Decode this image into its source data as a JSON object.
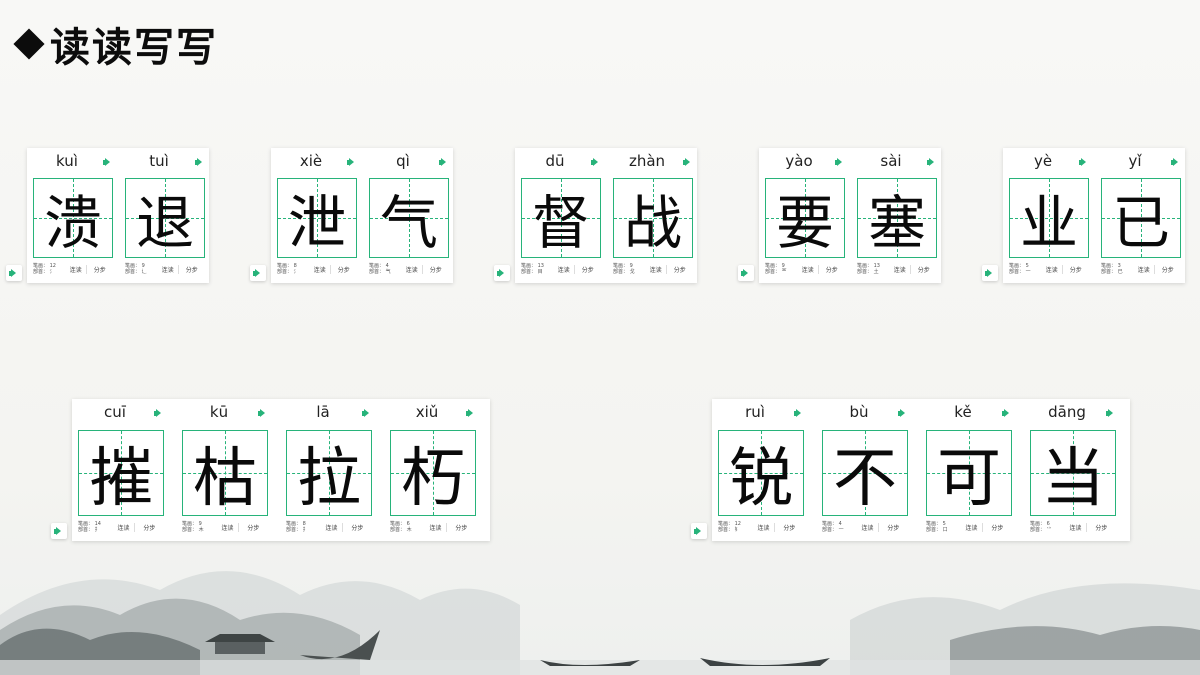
{
  "title": "读读写写",
  "labels": {
    "lian_du": "连读",
    "fen_bu": "分步",
    "stroke_prefix": "笔画：",
    "radical_prefix": "部首："
  },
  "colors": {
    "accent": "#27b37a"
  },
  "cards": [
    {
      "chars": [
        {
          "pinyin": "kuì",
          "hanzi": "溃",
          "strokes": "12",
          "radical": "氵"
        },
        {
          "pinyin": "tuì",
          "hanzi": "退",
          "strokes": "9",
          "radical": "辶"
        }
      ]
    },
    {
      "chars": [
        {
          "pinyin": "xiè",
          "hanzi": "泄",
          "strokes": "8",
          "radical": "氵"
        },
        {
          "pinyin": "qì",
          "hanzi": "气",
          "strokes": "4",
          "radical": "气"
        }
      ]
    },
    {
      "chars": [
        {
          "pinyin": "dū",
          "hanzi": "督",
          "strokes": "13",
          "radical": "目"
        },
        {
          "pinyin": "zhàn",
          "hanzi": "战",
          "strokes": "9",
          "radical": "戈"
        }
      ]
    },
    {
      "chars": [
        {
          "pinyin": "yào",
          "hanzi": "要",
          "strokes": "9",
          "radical": "覀"
        },
        {
          "pinyin": "sài",
          "hanzi": "塞",
          "strokes": "13",
          "radical": "土"
        }
      ]
    },
    {
      "chars": [
        {
          "pinyin": "yè",
          "hanzi": "业",
          "strokes": "5",
          "radical": "一"
        },
        {
          "pinyin": "yǐ",
          "hanzi": "已",
          "strokes": "3",
          "radical": "已"
        }
      ]
    },
    {
      "chars": [
        {
          "pinyin": "cuī",
          "hanzi": "摧",
          "strokes": "14",
          "radical": "扌"
        },
        {
          "pinyin": "kū",
          "hanzi": "枯",
          "strokes": "9",
          "radical": "木"
        },
        {
          "pinyin": "lā",
          "hanzi": "拉",
          "strokes": "8",
          "radical": "扌"
        },
        {
          "pinyin": "xiǔ",
          "hanzi": "朽",
          "strokes": "6",
          "radical": "木"
        }
      ]
    },
    {
      "chars": [
        {
          "pinyin": "ruì",
          "hanzi": "锐",
          "strokes": "12",
          "radical": "钅"
        },
        {
          "pinyin": "bù",
          "hanzi": "不",
          "strokes": "4",
          "radical": "一"
        },
        {
          "pinyin": "kě",
          "hanzi": "可",
          "strokes": "5",
          "radical": "口"
        },
        {
          "pinyin": "dāng",
          "hanzi": "当",
          "strokes": "6",
          "radical": "⺌"
        }
      ]
    }
  ]
}
